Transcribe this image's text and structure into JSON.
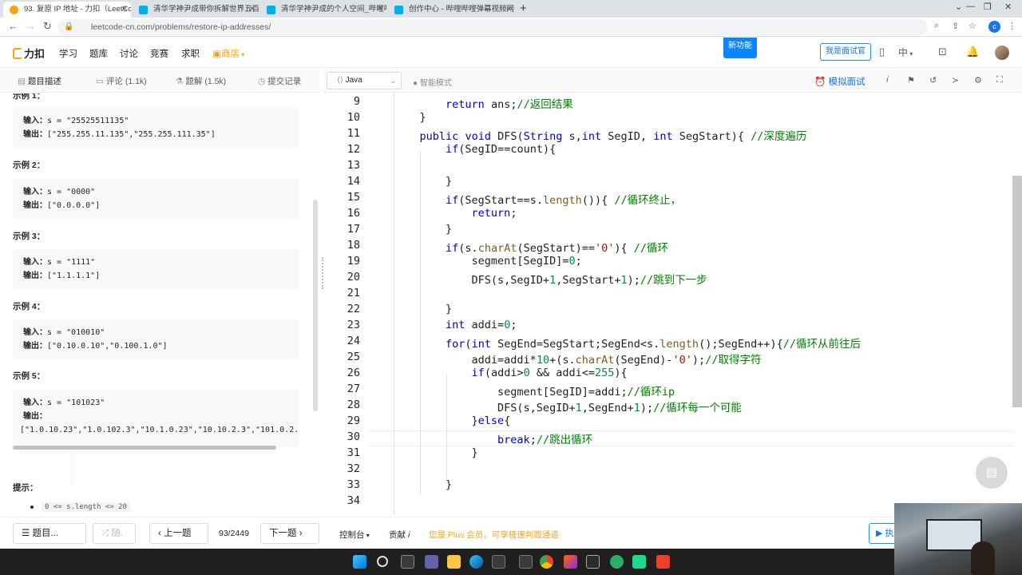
{
  "browser": {
    "tabs": [
      {
        "label": "93. 复原 IP 地址 - 力扣（LeetCo",
        "color": "#ffa116"
      },
      {
        "label": "清华学神尹成带你拆解世界五百",
        "color": "#00aeec"
      },
      {
        "label": "清华学神尹成的个人空间_哔哩哔",
        "color": "#00aeec"
      },
      {
        "label": "创作中心 - 哔哩哔哩弹幕视频网",
        "color": "#00aeec"
      }
    ],
    "new_tab": "+",
    "url": "leetcode-cn.com/problems/restore-ip-addresses/",
    "profile_initial": "c"
  },
  "nav": {
    "logo": "力扣",
    "items": [
      "学习",
      "题库",
      "讨论",
      "竞赛",
      "求职"
    ],
    "store": "商店",
    "new_feature": "新功能",
    "interviewer": "我是面试官",
    "lang": "中"
  },
  "left_tabs": [
    {
      "label": "题目描述",
      "icon": "document-icon"
    },
    {
      "label": "评论 (1.1k)",
      "icon": "comment-icon"
    },
    {
      "label": "题解 (1.5k)",
      "icon": "flask-icon"
    },
    {
      "label": "提交记录",
      "icon": "history-icon"
    }
  ],
  "examples": [
    {
      "title": "示例 1：",
      "input": "s = \"25525511135\"",
      "output": "[\"255.255.11.135\",\"255.255.111.35\"]"
    },
    {
      "title": "示例 2：",
      "input": "s = \"0000\"",
      "output": "[\"0.0.0.0\"]"
    },
    {
      "title": "示例 3：",
      "input": "s = \"1111\"",
      "output": "[\"1.1.1.1\"]"
    },
    {
      "title": "示例 4：",
      "input": "s = \"010010\"",
      "output": "[\"0.10.0.10\",\"0.100.1.0\"]"
    },
    {
      "title": "示例 5：",
      "input": "s = \"101023\"",
      "output": "[\"1.0.10.23\",\"1.0.102.3\",\"10.1.0.23\",\"10.10.2.3\",\"101.0.2."
    }
  ],
  "labels": {
    "input": "输入：",
    "output": "输出："
  },
  "hint": {
    "title": "提示：",
    "item": "0 <= s.length <= 20"
  },
  "editor_toolbar": {
    "language": "Java",
    "smart_mode": "智能模式",
    "mock_interview": "模拟面试"
  },
  "code_lines": [
    {
      "n": "9",
      "text": "        return ans;//返回结果"
    },
    {
      "n": "10",
      "text": "    }"
    },
    {
      "n": "11",
      "text": "    public void DFS(String s,int SegID, int SegStart){ //深度遍历"
    },
    {
      "n": "12",
      "text": "        if(SegID==count){"
    },
    {
      "n": "13",
      "text": ""
    },
    {
      "n": "14",
      "text": "        }"
    },
    {
      "n": "15",
      "text": "        if(SegStart==s.length()){ //循环终止，"
    },
    {
      "n": "16",
      "text": "            return;"
    },
    {
      "n": "17",
      "text": "        }"
    },
    {
      "n": "18",
      "text": "        if(s.charAt(SegStart)=='0'){ //循环"
    },
    {
      "n": "19",
      "text": "            segment[SegID]=0;"
    },
    {
      "n": "20",
      "text": "            DFS(s,SegID+1,SegStart+1);//跳到下一步"
    },
    {
      "n": "21",
      "text": ""
    },
    {
      "n": "22",
      "text": "        }"
    },
    {
      "n": "23",
      "text": "        int addi=0;"
    },
    {
      "n": "24",
      "text": "        for(int SegEnd=SegStart;SegEnd<s.length();SegEnd++){//循环从前往后"
    },
    {
      "n": "25",
      "text": "            addi=addi*10+(s.charAt(SegEnd)-'0');//取得字符"
    },
    {
      "n": "26",
      "text": "            if(addi>0 && addi<=255){"
    },
    {
      "n": "27",
      "text": "                segment[SegID]=addi;//循环ip"
    },
    {
      "n": "28",
      "text": "                DFS(s,SegID+1,SegEnd+1);//循环每一个可能"
    },
    {
      "n": "29",
      "text": "            }else{"
    },
    {
      "n": "30",
      "text": "                break;//跳出循环"
    },
    {
      "n": "31",
      "text": "            }"
    },
    {
      "n": "32",
      "text": ""
    },
    {
      "n": "33",
      "text": "        }"
    },
    {
      "n": "34",
      "text": ""
    }
  ],
  "bottom": {
    "problem_list": "题目...",
    "random": "随.",
    "prev": "上一题",
    "page": "93/2449",
    "next": "下一题",
    "console": "控制台",
    "contribute": "贡献",
    "plus_notice": "您是 Plus 会员，可享极速判题通道",
    "run": "执"
  },
  "colors": {
    "keyword": "#0000c8",
    "comment": "#008000",
    "number": "#098658",
    "string": "#a31515",
    "accent": "#1a73e8",
    "brand": "#ffa116"
  }
}
